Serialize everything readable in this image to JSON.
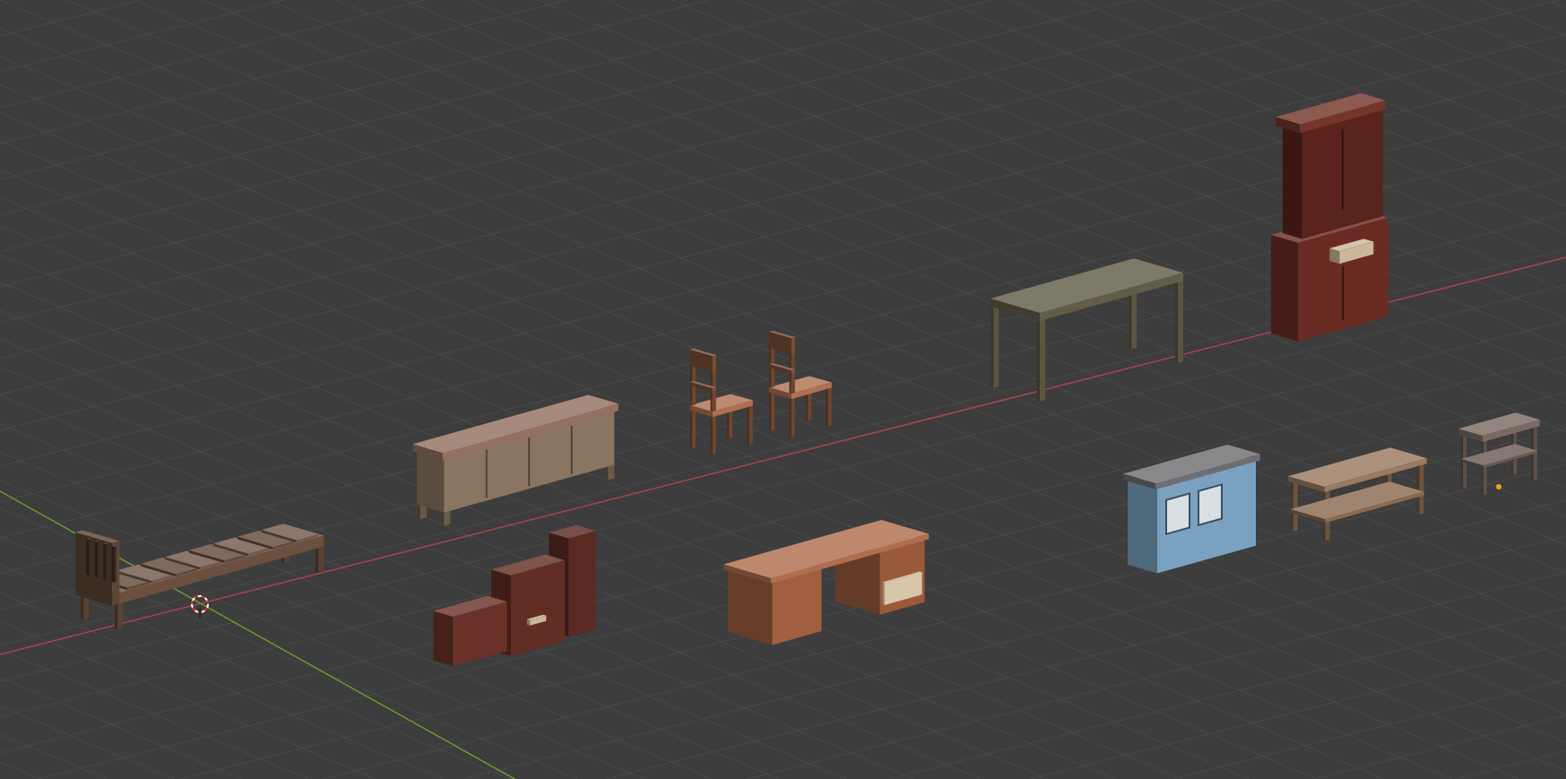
{
  "viewport": {
    "objects": [
      {
        "kind": "hutch"
      },
      {
        "kind": "table"
      },
      {
        "kind": "chair"
      },
      {
        "kind": "chair"
      },
      {
        "kind": "sideboard"
      },
      {
        "kind": "stool"
      },
      {
        "kind": "coffee_table"
      },
      {
        "kind": "bed"
      },
      {
        "kind": "island"
      },
      {
        "kind": "desk"
      },
      {
        "kind": "broken_cabinets"
      }
    ]
  }
}
